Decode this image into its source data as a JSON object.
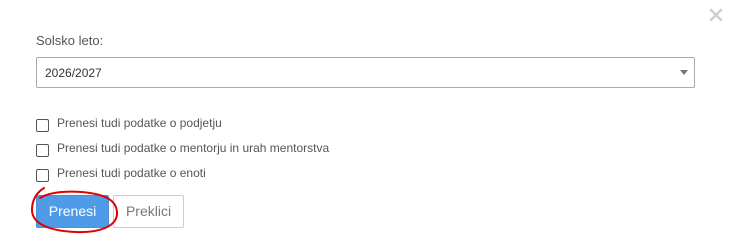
{
  "dialog": {
    "school_year_label": "Solsko leto:",
    "school_year_value": "2026/2027",
    "options": [
      {
        "label": "Prenesi tudi podatke o podjetju",
        "checked": false
      },
      {
        "label": "Prenesi tudi podatke o mentorju in urah mentorstva",
        "checked": false
      },
      {
        "label": "Prenesi tudi podatke o enoti",
        "checked": false
      }
    ],
    "submit_label": "Prenesi",
    "cancel_label": "Preklici",
    "close_icon": "close-icon"
  },
  "colors": {
    "primary_button": "#4f9be8",
    "annotation": "#e00000"
  }
}
